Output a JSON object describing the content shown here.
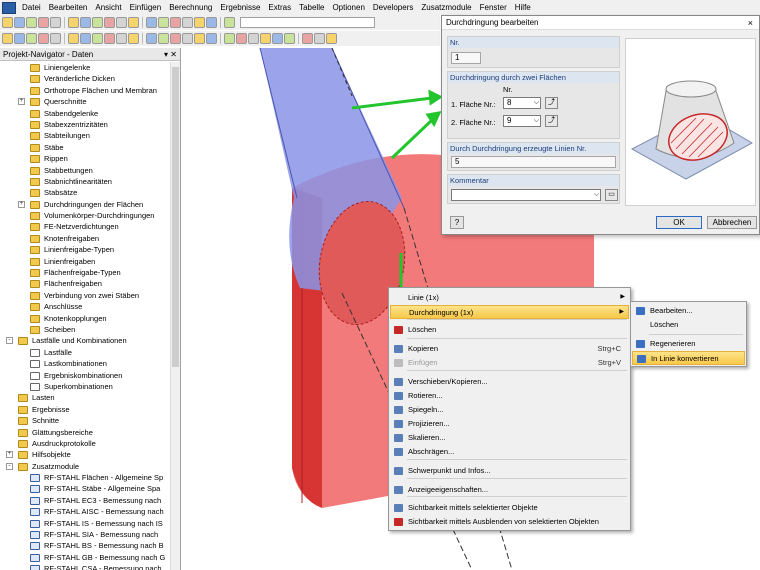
{
  "menubar": [
    "Datei",
    "Bearbeiten",
    "Ansicht",
    "Einfügen",
    "Berechnung",
    "Ergebnisse",
    "Extras",
    "Tabelle",
    "Optionen",
    "Developers",
    "Zusatzmodule",
    "Fenster",
    "Hilfe"
  ],
  "navigator": {
    "title": "Projekt-Navigator - Daten",
    "items": [
      {
        "label": "Liniengelenke",
        "indent": 2,
        "icon": "folder",
        "exp": ""
      },
      {
        "label": "Veränderliche Dicken",
        "indent": 2,
        "icon": "folder",
        "exp": ""
      },
      {
        "label": "Orthotrope Flächen und Membran",
        "indent": 2,
        "icon": "folder",
        "exp": ""
      },
      {
        "label": "Querschnitte",
        "indent": 2,
        "icon": "folder",
        "exp": "+"
      },
      {
        "label": "Stabendgelenke",
        "indent": 2,
        "icon": "folder",
        "exp": ""
      },
      {
        "label": "Stabexzentrizitäten",
        "indent": 2,
        "icon": "folder",
        "exp": ""
      },
      {
        "label": "Stabteilungen",
        "indent": 2,
        "icon": "folder",
        "exp": ""
      },
      {
        "label": "Stäbe",
        "indent": 2,
        "icon": "folder",
        "exp": ""
      },
      {
        "label": "Rippen",
        "indent": 2,
        "icon": "folder",
        "exp": ""
      },
      {
        "label": "Stabbettungen",
        "indent": 2,
        "icon": "folder",
        "exp": ""
      },
      {
        "label": "Stabnichtlinearitäten",
        "indent": 2,
        "icon": "folder",
        "exp": ""
      },
      {
        "label": "Stabsätze",
        "indent": 2,
        "icon": "folder",
        "exp": ""
      },
      {
        "label": "Durchdringungen der Flächen",
        "indent": 2,
        "icon": "folder",
        "exp": "+"
      },
      {
        "label": "Volumenkörper-Durchdringungen",
        "indent": 2,
        "icon": "folder",
        "exp": ""
      },
      {
        "label": "FE-Netzverdichtungen",
        "indent": 2,
        "icon": "folder",
        "exp": ""
      },
      {
        "label": "Knotenfreigaben",
        "indent": 2,
        "icon": "folder",
        "exp": ""
      },
      {
        "label": "Linienfreigabe-Typen",
        "indent": 2,
        "icon": "folder",
        "exp": ""
      },
      {
        "label": "Linienfreigaben",
        "indent": 2,
        "icon": "folder",
        "exp": ""
      },
      {
        "label": "Flächenfreigabe-Typen",
        "indent": 2,
        "icon": "folder",
        "exp": ""
      },
      {
        "label": "Flächenfreigaben",
        "indent": 2,
        "icon": "folder",
        "exp": ""
      },
      {
        "label": "Verbindung von zwei Stäben",
        "indent": 2,
        "icon": "folder",
        "exp": ""
      },
      {
        "label": "Anschlüsse",
        "indent": 2,
        "icon": "folder",
        "exp": ""
      },
      {
        "label": "Knotenkopplungen",
        "indent": 2,
        "icon": "folder",
        "exp": ""
      },
      {
        "label": "Scheiben",
        "indent": 2,
        "icon": "folder",
        "exp": ""
      },
      {
        "label": "Lastfälle und Kombinationen",
        "indent": 1,
        "icon": "folder",
        "exp": "-"
      },
      {
        "label": "Lastfälle",
        "indent": 2,
        "icon": "lc",
        "exp": ""
      },
      {
        "label": "Lastkombinationen",
        "indent": 2,
        "icon": "lc",
        "exp": ""
      },
      {
        "label": "Ergebniskombinationen",
        "indent": 2,
        "icon": "lc",
        "exp": ""
      },
      {
        "label": "Superkombinationen",
        "indent": 2,
        "icon": "lc",
        "exp": ""
      },
      {
        "label": "Lasten",
        "indent": 1,
        "icon": "folder",
        "exp": ""
      },
      {
        "label": "Ergebnisse",
        "indent": 1,
        "icon": "folder",
        "exp": ""
      },
      {
        "label": "Schnitte",
        "indent": 1,
        "icon": "folder",
        "exp": ""
      },
      {
        "label": "Glättungsbereiche",
        "indent": 1,
        "icon": "folder",
        "exp": ""
      },
      {
        "label": "Ausdruckprotokolle",
        "indent": 1,
        "icon": "folder",
        "exp": ""
      },
      {
        "label": "Hilfsobjekte",
        "indent": 1,
        "icon": "folder",
        "exp": "+"
      },
      {
        "label": "Zusatzmodule",
        "indent": 1,
        "icon": "folder",
        "exp": "-"
      },
      {
        "label": "RF-STAHL Flächen - Allgemeine Sp",
        "indent": 2,
        "icon": "mod",
        "exp": ""
      },
      {
        "label": "RF-STAHL Stäbe - Allgemeine Spa",
        "indent": 2,
        "icon": "mod",
        "exp": ""
      },
      {
        "label": "RF-STAHL EC3 - Bemessung nach",
        "indent": 2,
        "icon": "mod",
        "exp": ""
      },
      {
        "label": "RF-STAHL AISC - Bemessung nach",
        "indent": 2,
        "icon": "mod",
        "exp": ""
      },
      {
        "label": "RF-STAHL IS - Bemessung nach IS",
        "indent": 2,
        "icon": "mod",
        "exp": ""
      },
      {
        "label": "RF-STAHL SIA - Bemessung nach",
        "indent": 2,
        "icon": "mod",
        "exp": ""
      },
      {
        "label": "RF-STAHL BS - Bemessung nach B",
        "indent": 2,
        "icon": "mod",
        "exp": ""
      },
      {
        "label": "RF-STAHL GB - Bemessung nach G",
        "indent": 2,
        "icon": "mod",
        "exp": ""
      },
      {
        "label": "RF-STAHL CSA - Bemessung nach",
        "indent": 2,
        "icon": "mod",
        "exp": ""
      }
    ]
  },
  "dialog": {
    "title": "Durchdringung bearbeiten",
    "close": "×",
    "nr_label": "Nr.",
    "nr_value": "1",
    "group1_title": "Durchdringung durch zwei Flächen",
    "nr_col_label": "Nr.",
    "flaeche1_label": "1. Fläche Nr.:",
    "flaeche1_value": "8",
    "flaeche2_label": "2. Fläche Nr.:",
    "flaeche2_value": "9",
    "group2_title": "Durch Durchdringung erzeugte Linien Nr.",
    "linien_value": "5",
    "group3_title": "Kommentar",
    "kommentar_value": "",
    "help": "?",
    "ok": "OK",
    "cancel": "Abbrechen"
  },
  "context_menu": {
    "items": [
      {
        "label": "Linie (1x)",
        "shortcut": "",
        "sub": true,
        "state": "normal",
        "icon": ""
      },
      {
        "label": "Durchdringung (1x)",
        "shortcut": "",
        "sub": true,
        "state": "hl",
        "icon": ""
      },
      {
        "label": "Löschen",
        "shortcut": "",
        "sub": false,
        "state": "normal",
        "icon": "#c62828"
      },
      {
        "label": "Kopieren",
        "shortcut": "Strg+C",
        "sub": false,
        "state": "normal",
        "icon": "#5a7fb8"
      },
      {
        "label": "Einfügen",
        "shortcut": "Strg+V",
        "sub": false,
        "state": "dis",
        "icon": "#bdbdbd"
      },
      {
        "label": "Verschieben/Kopieren...",
        "shortcut": "",
        "sub": false,
        "state": "normal",
        "icon": "#5a7fb8"
      },
      {
        "label": "Rotieren...",
        "shortcut": "",
        "sub": false,
        "state": "normal",
        "icon": "#5a7fb8"
      },
      {
        "label": "Spiegeln...",
        "shortcut": "",
        "sub": false,
        "state": "normal",
        "icon": "#5a7fb8"
      },
      {
        "label": "Projizieren...",
        "shortcut": "",
        "sub": false,
        "state": "normal",
        "icon": "#5a7fb8"
      },
      {
        "label": "Skalieren...",
        "shortcut": "",
        "sub": false,
        "state": "normal",
        "icon": "#5a7fb8"
      },
      {
        "label": "Abschrägen...",
        "shortcut": "",
        "sub": false,
        "state": "normal",
        "icon": "#5a7fb8"
      },
      {
        "label": "Schwerpunkt und Infos...",
        "shortcut": "",
        "sub": false,
        "state": "normal",
        "icon": "#5a7fb8"
      },
      {
        "label": "Anzeigeeigenschaften...",
        "shortcut": "",
        "sub": false,
        "state": "normal",
        "icon": "#5a7fb8"
      },
      {
        "label": "Sichtbarkeit mittels selektierter Objekte",
        "shortcut": "",
        "sub": false,
        "state": "normal",
        "icon": "#5a7fb8"
      },
      {
        "label": "Sichtbarkeit mittels Ausblenden von selektierten Objekten",
        "shortcut": "",
        "sub": false,
        "state": "normal",
        "icon": "#c62828"
      }
    ]
  },
  "submenu": {
    "items": [
      {
        "label": "Bearbeiten...",
        "state": "normal",
        "icon": "#3a6fc1"
      },
      {
        "label": "Löschen",
        "state": "normal",
        "icon": ""
      },
      {
        "label": "Regenerieren",
        "state": "normal",
        "icon": "#3a6fc1"
      },
      {
        "label": "In Linie konvertieren",
        "state": "hl",
        "icon": "#3a6fc1"
      }
    ]
  }
}
